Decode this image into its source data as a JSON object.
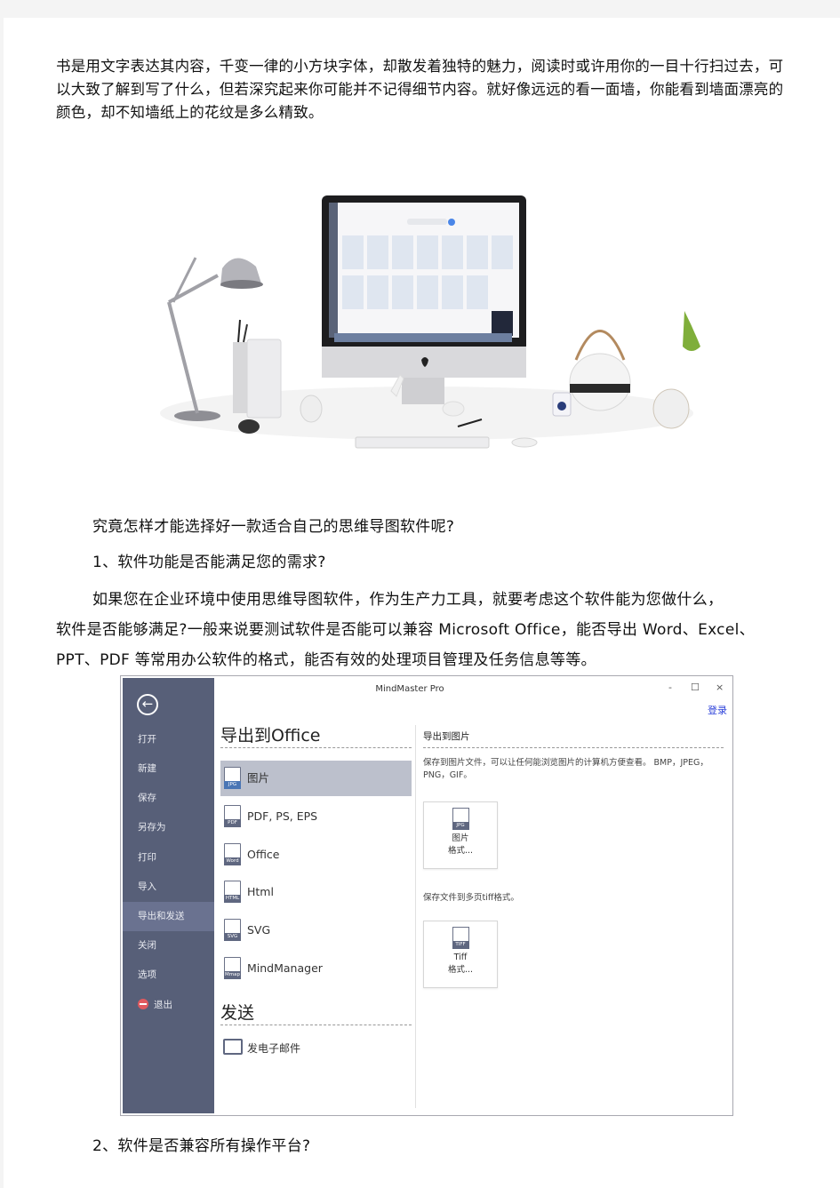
{
  "intro_paragraph": "书是用文字表达其内容，千变一律的小方块字体，却散发着独特的魅力，阅读时或许用你的一目十行扫过去，可以大致了解到写了什么，但若深究起来你可能并不记得细节内容。就好像远远的看一面墙，你能看到墙面漂亮的颜色，却不知墙纸上的花纹是多么精致。",
  "photo": {
    "description": "desk-scene-with-imac-lamp-teapot",
    "colors": {
      "screen_frame": "#1d1d1f",
      "chin": "#d9d9dc",
      "lamp": "#9a9aa0",
      "plant": "#7fae3a"
    }
  },
  "question_line": "究竟怎样才能选择好一款适合自己的思维导图软件呢?",
  "point1_heading": "1、软件功能是否能满足您的需求?",
  "point1_body": [
    "如果您在企业环境中使用思维导图软件，作为生产力工具，就要考虑这个软件能为您做什么，",
    "软件是否能够满足?一般来说要测试软件是否能可以兼容 Microsoft Office，能否导出 Word、Excel、",
    "PPT、PDF 等常用办公软件的格式，能否有效的处理项目管理及任务信息等等。"
  ],
  "mindmaster": {
    "window_title": "MindMaster Pro",
    "window_controls": {
      "minimize": "-",
      "maximize": "☐",
      "close": "×"
    },
    "login_link": "登录",
    "back_icon": "←",
    "sidebar_items": [
      {
        "label": "打开"
      },
      {
        "label": "新建"
      },
      {
        "label": "保存"
      },
      {
        "label": "另存为"
      },
      {
        "label": "打印"
      },
      {
        "label": "导入"
      },
      {
        "label": "导出和发送",
        "active": true
      },
      {
        "label": "关闭"
      },
      {
        "label": "选项"
      },
      {
        "label": "退出"
      }
    ],
    "export_heading": "导出到Office",
    "export_items": [
      {
        "label": "图片",
        "icon_tag": "JPG",
        "active": true
      },
      {
        "label": "PDF, PS, EPS",
        "icon_tag": "PDF"
      },
      {
        "label": "Office",
        "icon_tag": "Word"
      },
      {
        "label": "Html",
        "icon_tag": "HTML"
      },
      {
        "label": "SVG",
        "icon_tag": "SVG"
      },
      {
        "label": "MindManager",
        "icon_tag": "Mmap"
      }
    ],
    "send_heading": "发送",
    "send_items": [
      {
        "label": "发电子邮件"
      }
    ],
    "right_panel": {
      "title": "导出到图片",
      "description": "保存到图片文件，可以让任何能浏览图片的计算机方便查看。 BMP，JPEG，PNG，GIF。",
      "card1": {
        "line1": "图片",
        "line2": "格式...",
        "icon_tag": "JPG"
      },
      "description2": "保存文件到多页tiff格式。",
      "card2": {
        "line1": "Tiff",
        "line2": "格式...",
        "icon_tag": "TIFF"
      }
    },
    "colors": {
      "sidebar": "#575f78",
      "sidebar_active": "#6a7290",
      "list_active": "#bcc0cc",
      "login": "#2a3fd9",
      "exit_icon": "#e05a5f"
    }
  },
  "point2_heading": "2、软件是否兼容所有操作平台?"
}
